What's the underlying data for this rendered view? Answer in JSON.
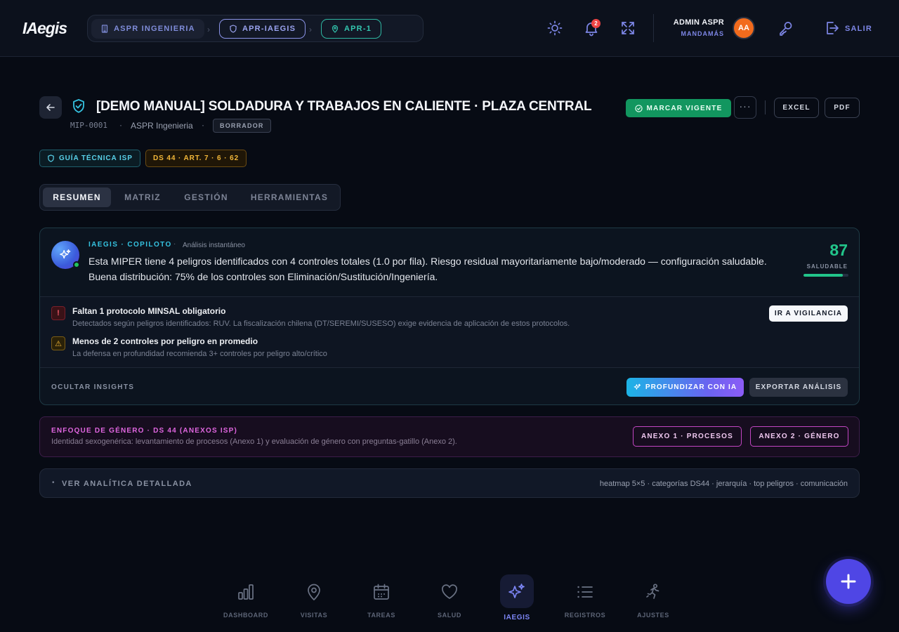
{
  "header": {
    "logo": "IAegis",
    "breadcrumbs": [
      {
        "label": "ASPR INGENIERIA",
        "icon": "building-icon"
      },
      {
        "label": "APR-IAEGIS",
        "icon": "shield-icon"
      },
      {
        "label": "APR-1",
        "icon": "map-pin-icon"
      }
    ],
    "notifications_count": "2",
    "user": {
      "name": "ADMIN ASPR",
      "role": "MANDAMÁS",
      "initials": "AA"
    },
    "logout_label": "SALIR"
  },
  "document": {
    "title": "[DEMO MANUAL] SOLDADURA Y TRABAJOS EN CALIENTE · PLAZA CENTRAL",
    "code": "MIP-0001",
    "separator": "·",
    "company": "ASPR Ingenieria",
    "status": "BORRADOR",
    "actions": {
      "mark_current": "MARCAR VIGENTE",
      "more": "···",
      "excel": "EXCEL",
      "pdf": "PDF"
    },
    "tags": [
      {
        "label": "GUÍA TÉCNICA ISP",
        "icon": "shield-icon"
      },
      {
        "label": "DS 44 · ART. 7 · 6 · 62"
      }
    ]
  },
  "tabs": [
    {
      "label": "RESUMEN",
      "active": true
    },
    {
      "label": "MATRIZ",
      "active": false
    },
    {
      "label": "GESTIÓN",
      "active": false
    },
    {
      "label": "HERRAMIENTAS",
      "active": false
    }
  ],
  "copilot": {
    "brand": "IAEGIS · COPILOTO",
    "separator": "·",
    "mode": "Análisis instantáneo",
    "summary": "Esta MIPER tiene 4 peligros identificados con 4 controles totales (1.0 por fila). Riesgo residual mayoritariamente bajo/moderado — configuración saludable. Buena distribución: 75% de los controles son Eliminación/Sustitución/Ingeniería.",
    "score": {
      "value": "87",
      "label": "SALUDABLE",
      "fraction": 0.87,
      "color": "#22c58a"
    },
    "insights": [
      {
        "severity": "danger",
        "icon_glyph": "!",
        "title": "Faltan 1 protocolo MINSAL obligatorio",
        "description": "Detectados según peligros identificados: RUV. La fiscalización chilena (DT/SEREMI/SUSESO) exige evidencia de aplicación de estos protocolos."
      },
      {
        "severity": "warning",
        "icon_glyph": "⚠",
        "title": "Menos de 2 controles por peligro en promedio",
        "description": "La defensa en profundidad recomienda 3+ controles por peligro alto/crítico"
      }
    ],
    "go_vigilance": "IR A VIGILANCIA",
    "hide_insights": "OCULTAR INSIGHTS",
    "deepen_ai": "PROFUNDIZAR CON IA",
    "export_analysis": "EXPORTAR ANÁLISIS"
  },
  "gender": {
    "title": "ENFOQUE DE GÉNERO · DS 44 (ANEXOS ISP)",
    "description": "Identidad sexogenérica: levantamiento de procesos (Anexo 1) y evaluación de género con preguntas-gatillo (Anexo 2).",
    "annex1": "ANEXO 1 · PROCESOS",
    "annex2": "ANEXO 2 · GÉNERO"
  },
  "analytics": {
    "bullet": "•",
    "label": "VER ANALÍTICA DETALLADA",
    "hint": "heatmap 5×5 · categorías DS44 · jerarquía · top peligros · comunicación"
  },
  "bottom_nav": [
    {
      "label": "DASHBOARD",
      "icon": "bar-chart-icon",
      "active": false
    },
    {
      "label": "VISITAS",
      "icon": "map-pin-icon",
      "active": false
    },
    {
      "label": "TAREAS",
      "icon": "calendar-icon",
      "active": false
    },
    {
      "label": "SALUD",
      "icon": "heart-icon",
      "active": false
    },
    {
      "label": "IAEGIS",
      "icon": "sparkles-icon",
      "active": true
    },
    {
      "label": "REGISTROS",
      "icon": "list-icon",
      "active": false
    },
    {
      "label": "AJUSTES",
      "icon": "running-figure-icon",
      "active": false
    }
  ],
  "colors": {
    "accent": "#7d86e6",
    "success": "#12965f",
    "cyan": "#35c2e0",
    "danger": "#ef4444",
    "warning": "#f2b739",
    "magenta": "#c246c2",
    "fab": "#4f46e5"
  }
}
